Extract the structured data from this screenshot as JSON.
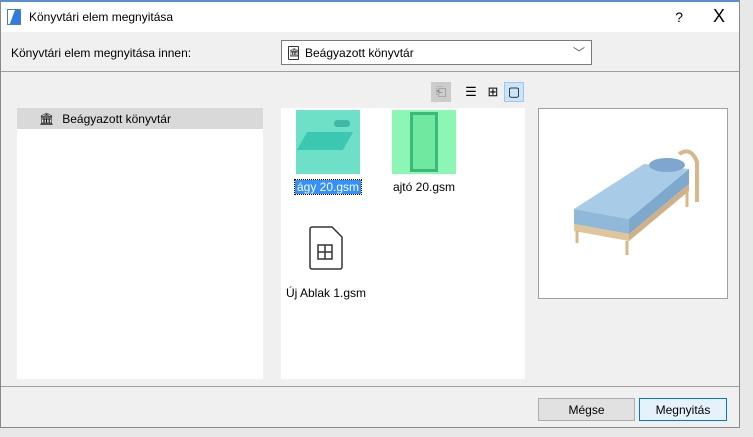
{
  "window": {
    "title": "Könyvtári elem megnyitása",
    "help": "?",
    "close": "X"
  },
  "source": {
    "label": "Könyvtári elem megnyitása innen:",
    "value": "Beágyazott könyvtár"
  },
  "tree": {
    "items": [
      {
        "label": "Beágyazott könyvtár"
      }
    ]
  },
  "files": [
    {
      "name": "ágy 20.gsm"
    },
    {
      "name": "ajtó 20.gsm"
    },
    {
      "name": "Új Ablak 1.gsm"
    }
  ],
  "buttons": {
    "cancel": "Mégse",
    "open": "Megnyitás"
  }
}
